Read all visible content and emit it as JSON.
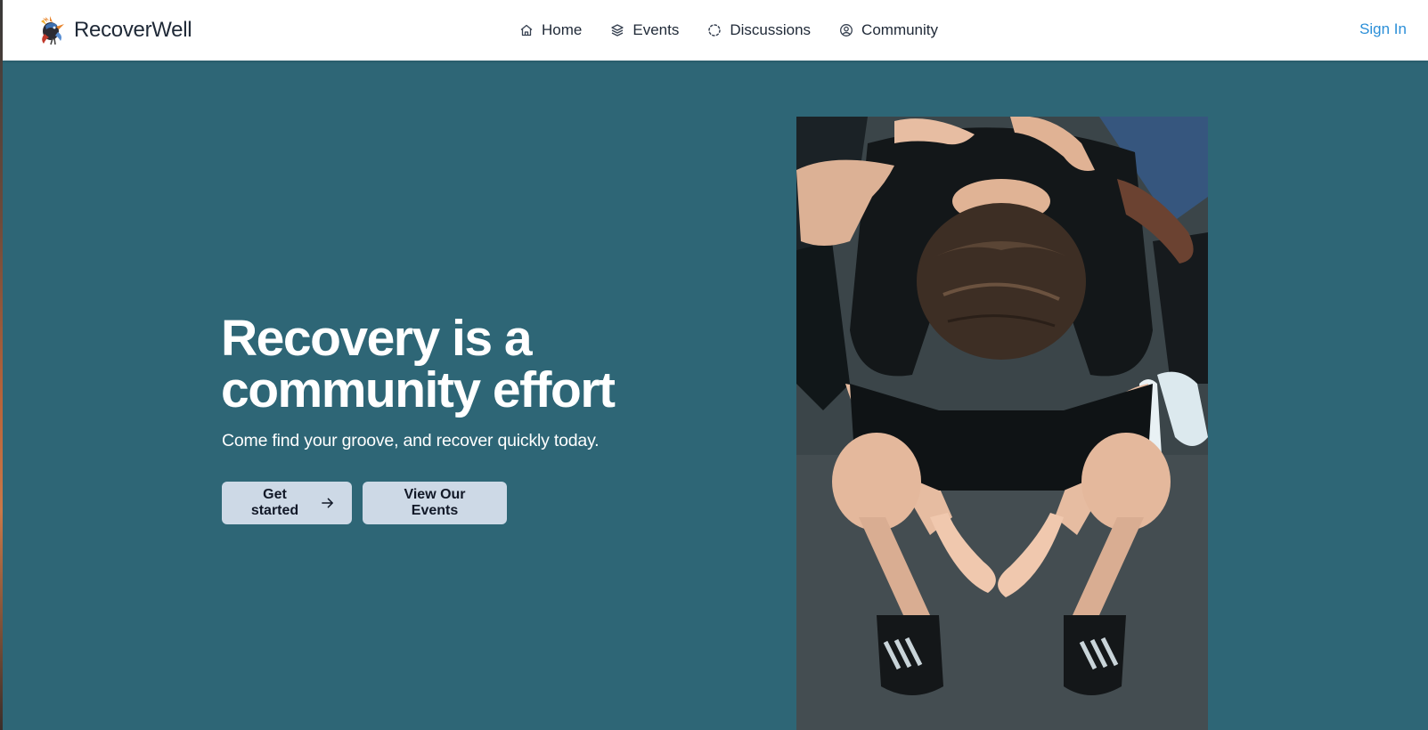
{
  "brand": {
    "name": "RecoverWell",
    "logo_icon": "phoenix-logo-icon"
  },
  "nav": {
    "items": [
      {
        "label": "Home",
        "icon": "home-icon"
      },
      {
        "label": "Events",
        "icon": "layers-icon"
      },
      {
        "label": "Discussions",
        "icon": "dashed-circle-icon"
      },
      {
        "label": "Community",
        "icon": "user-circle-icon"
      }
    ],
    "sign_in": "Sign In"
  },
  "hero": {
    "headline_line1": "Recovery is a",
    "headline_line2": "community effort",
    "subtitle": "Come find your groove, and recover quickly today.",
    "primary_button": "Get started",
    "secondary_button": "View Our Events",
    "image_alt": "person kneeling with open hands surrounded by supportive hands"
  },
  "colors": {
    "hero_background": "#2e6676",
    "button_background": "#cdd9e6",
    "sign_in_link": "#2b8fd8",
    "nav_text": "#1f2937"
  }
}
